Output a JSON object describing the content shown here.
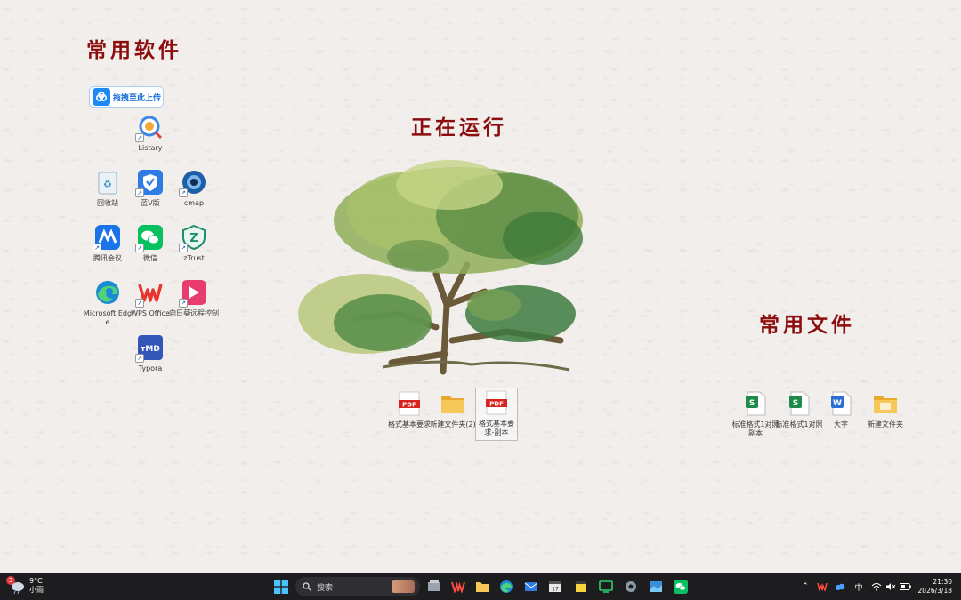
{
  "headings": {
    "software": "常用软件",
    "running": "正在运行",
    "files": "常用文件"
  },
  "upload_chip": {
    "label": "拖拽至此上传"
  },
  "software_icons": [
    {
      "label": "Listary",
      "icon": "listary-icon"
    },
    {
      "label": "回收站",
      "icon": "recycle-bin-icon"
    },
    {
      "label": "蓝V版",
      "icon": "shield-app-icon"
    },
    {
      "label": "cmap",
      "icon": "cmap-icon"
    },
    {
      "label": "腾讯会议",
      "icon": "tencent-meeting-icon"
    },
    {
      "label": "微信",
      "icon": "wechat-icon"
    },
    {
      "label": "zTrust",
      "icon": "ztrust-icon"
    },
    {
      "label": "Microsoft Edge",
      "icon": "edge-icon"
    },
    {
      "label": "WPS Office",
      "icon": "wps-office-icon"
    },
    {
      "label": "向日葵远程控制",
      "icon": "sunflower-remote-icon"
    },
    {
      "label": "Typora",
      "icon": "typora-icon"
    }
  ],
  "running_files": [
    {
      "label": "格式基本要求",
      "type": "PDF"
    },
    {
      "label": "新建文件夹(2)",
      "type": "folder"
    },
    {
      "label": "格式基本要求-副本",
      "type": "PDF"
    }
  ],
  "common_files": [
    {
      "label": "标准格式1对照副本",
      "type": "S"
    },
    {
      "label": "标准格式1对照",
      "type": "S"
    },
    {
      "label": "大字",
      "type": "W"
    },
    {
      "label": "新建文件夹",
      "type": "folder"
    }
  ],
  "taskbar": {
    "weather": {
      "badge": "3",
      "temp": "9°C",
      "desc": "小雨"
    },
    "search_placeholder": "搜索",
    "apps": [
      "file-manager-icon",
      "wps-icon",
      "file-explorer-icon",
      "edge-icon",
      "mail-icon",
      "calendar-icon",
      "sticky-notes-icon",
      "chat-icon",
      "settings-icon",
      "photos-icon",
      "wechat-icon"
    ],
    "ime": "中",
    "clock": {
      "time": "21:30",
      "date": "2026/3/18"
    }
  },
  "colors": {
    "heading": "#8b0d0d",
    "background": "#f1eeeb",
    "taskbar": "#1d1d1f",
    "pdf": "#d9241e",
    "folder": "#f2c14e",
    "sheet": "#1f8a4a",
    "word": "#2b6fd6"
  }
}
